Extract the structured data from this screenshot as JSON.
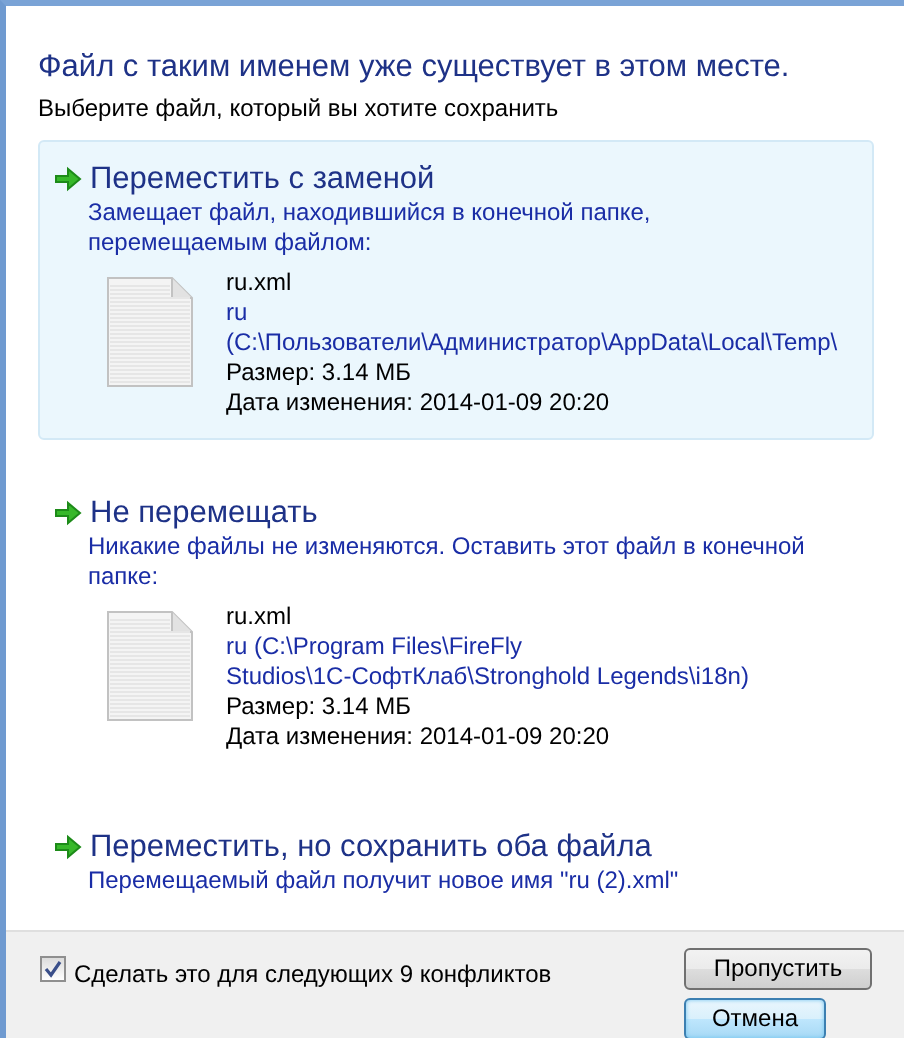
{
  "heading": "Файл с таким именем уже существует в этом месте.",
  "subheading": "Выберите файл, который вы хотите сохранить",
  "options": [
    {
      "title": "Переместить с заменой",
      "description": "Замещает файл, находившийся в конечной папке, перемещаемым файлом:",
      "selected": true,
      "file": {
        "name": "ru.xml",
        "location_lines": [
          "ru",
          "(C:\\Пользователи\\Администратор\\AppData\\Local\\Temp\\"
        ],
        "size": "Размер: 3.14 МБ",
        "modified": "Дата изменения: 2014-01-09 20:20"
      }
    },
    {
      "title": "Не перемещать",
      "description": "Никакие файлы не изменяются. Оставить этот файл в конечной папке:",
      "selected": false,
      "file": {
        "name": "ru.xml",
        "location_lines": [
          "ru (C:\\Program Files\\FireFly",
          "Studios\\1С-СофтКлаб\\Stronghold Legends\\i18n)"
        ],
        "size": "Размер: 3.14 МБ",
        "modified": "Дата изменения: 2014-01-09 20:20"
      }
    },
    {
      "title": "Переместить, но сохранить оба файла",
      "description": "Перемещаемый файл получит новое имя \"ru (2).xml\"",
      "selected": false
    }
  ],
  "footer": {
    "checkbox": {
      "label": "Сделать это для следующих 9 конфликтов",
      "checked": true
    },
    "buttons": [
      {
        "label": "Пропустить",
        "default": false
      },
      {
        "label": "Отмена",
        "default": true
      }
    ]
  }
}
